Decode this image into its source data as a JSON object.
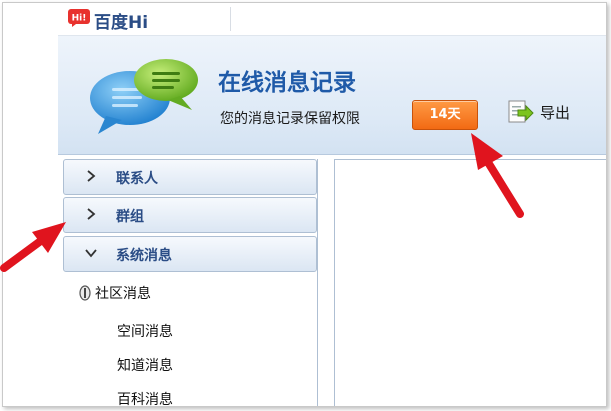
{
  "app": {
    "name": "百度Hi",
    "logo_text": "Hi!"
  },
  "header": {
    "title": "在线消息记录",
    "retention_label": "您的消息记录保留权限",
    "retention_badge": "14天",
    "export_label": "导出"
  },
  "sidebar": {
    "groups": [
      {
        "label": "联系人",
        "expanded": false
      },
      {
        "label": "群组",
        "expanded": false
      },
      {
        "label": "系统消息",
        "expanded": true
      }
    ],
    "tree_root": "社区消息",
    "tree_children": [
      "空间消息",
      "知道消息",
      "百科消息"
    ]
  },
  "colors": {
    "title_blue": "#1f5aa8",
    "badge_orange": "#f26a13",
    "annotation_red": "#e0141e"
  },
  "icons": {
    "logo": "baidu-hi-logo-icon",
    "header": "chat-bubbles-icon",
    "export": "export-icon",
    "collapsed": "chevron-right-icon",
    "expanded": "chevron-down-icon",
    "tree_root": "toggle-icon"
  }
}
